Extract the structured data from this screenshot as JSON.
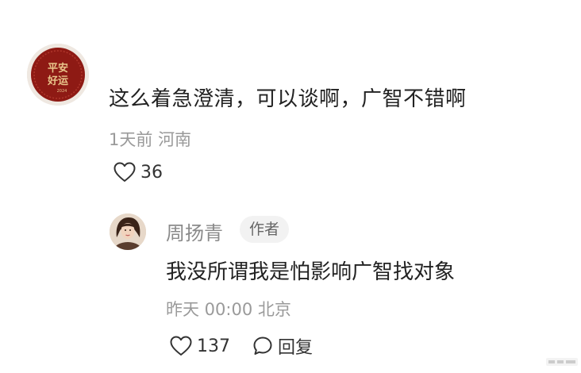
{
  "comment": {
    "avatar_icon": "ping-an-hao-yun-seal-avatar",
    "avatar_text_top": "平安",
    "avatar_text_bottom": "好运",
    "avatar_year": "2024",
    "text": "这么着急澄清，可以谈啊，广智不错啊",
    "time": "1天前",
    "location": "河南",
    "likes": "36",
    "like_icon": "heart-outline-icon"
  },
  "reply": {
    "avatar_icon": "user-photo-avatar",
    "name": "周扬青",
    "author_badge": "作者",
    "text": "我没所谓我是怕影响广智找对象",
    "time": "昨天 00:00",
    "location": "北京",
    "likes": "137",
    "like_icon": "heart-outline-icon",
    "reply_label": "回复",
    "reply_icon": "speech-bubble-icon"
  },
  "colors": {
    "avatar_red": "#8e1a14",
    "avatar_gold": "#e8c48a",
    "text_primary": "#222222",
    "text_muted": "#9a9a9a",
    "badge_bg": "#f2f2f2"
  }
}
